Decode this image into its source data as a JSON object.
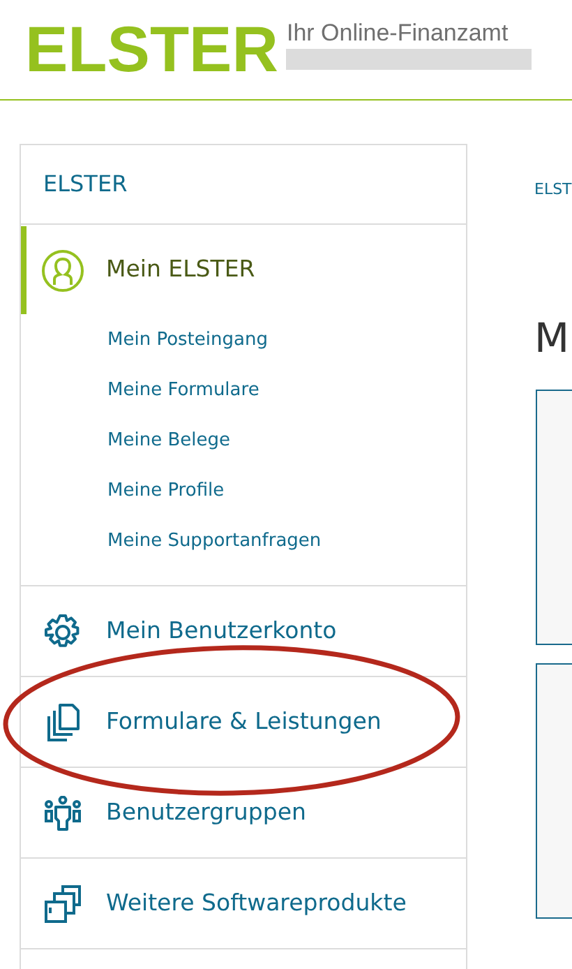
{
  "header": {
    "logo": "ELSTER",
    "tagline": "Ihr Online-Finanzamt"
  },
  "sidebar": {
    "title": "ELSTER",
    "items": [
      {
        "label": "Mein ELSTER",
        "kind": "person",
        "selected": true,
        "children": [
          {
            "label": "Mein Posteingang"
          },
          {
            "label": "Meine Formulare"
          },
          {
            "label": "Meine Belege"
          },
          {
            "label": "Meine Profile"
          },
          {
            "label": "Meine Supportanfragen"
          }
        ]
      },
      {
        "label": "Mein Benutzerkonto",
        "kind": "gear",
        "selected": false
      },
      {
        "label": "Formulare & Leistungen",
        "kind": "documents",
        "selected": false
      },
      {
        "label": "Benutzergruppen",
        "kind": "group",
        "selected": false
      },
      {
        "label": "Weitere Softwareprodukte",
        "kind": "windows",
        "selected": false
      }
    ]
  },
  "main": {
    "breadcrumb": "ELST",
    "heading": "M",
    "cards": [
      {
        "kind": "card"
      },
      {
        "kind": "card"
      }
    ]
  },
  "annotation": {
    "kind": "ellipse"
  }
}
